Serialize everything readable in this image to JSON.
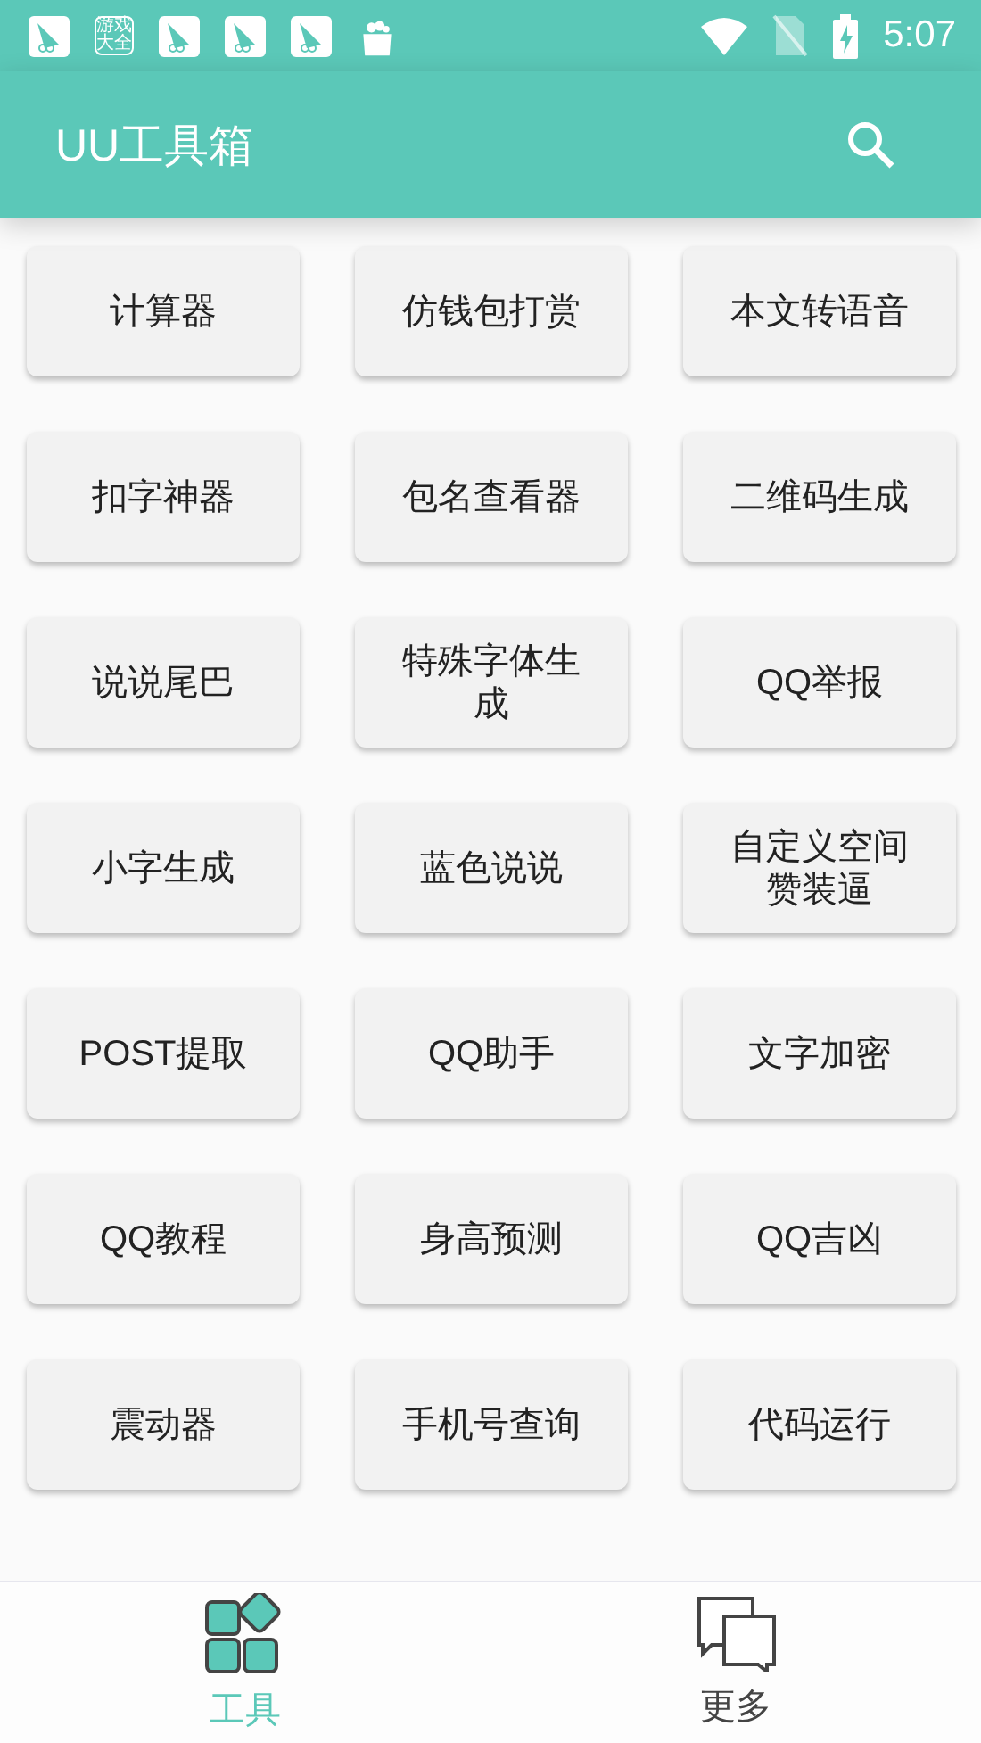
{
  "status_bar": {
    "notification_badge": [
      "游戏",
      "大全"
    ],
    "time": "5:07"
  },
  "app_bar": {
    "title": "UU工具箱"
  },
  "tools": [
    {
      "label": "计算器"
    },
    {
      "label": "仿钱包打赏"
    },
    {
      "label": "本文转语音"
    },
    {
      "label": "扣字神器"
    },
    {
      "label": "包名查看器"
    },
    {
      "label": "二维码生成"
    },
    {
      "label": "说说尾巴"
    },
    {
      "label": "特殊字体生成"
    },
    {
      "label": "QQ举报"
    },
    {
      "label": "小字生成"
    },
    {
      "label": "蓝色说说"
    },
    {
      "label": "自定义空间赞装逼"
    },
    {
      "label": "POST提取"
    },
    {
      "label": "QQ助手"
    },
    {
      "label": "文字加密"
    },
    {
      "label": "QQ教程"
    },
    {
      "label": "身高预测"
    },
    {
      "label": "QQ吉凶"
    },
    {
      "label": "震动器"
    },
    {
      "label": "手机号查询"
    },
    {
      "label": "代码运行"
    }
  ],
  "bottom_nav": [
    {
      "label": "工具",
      "kind": "grid",
      "selected": true
    },
    {
      "label": "更多",
      "kind": "chat",
      "selected": false
    }
  ]
}
